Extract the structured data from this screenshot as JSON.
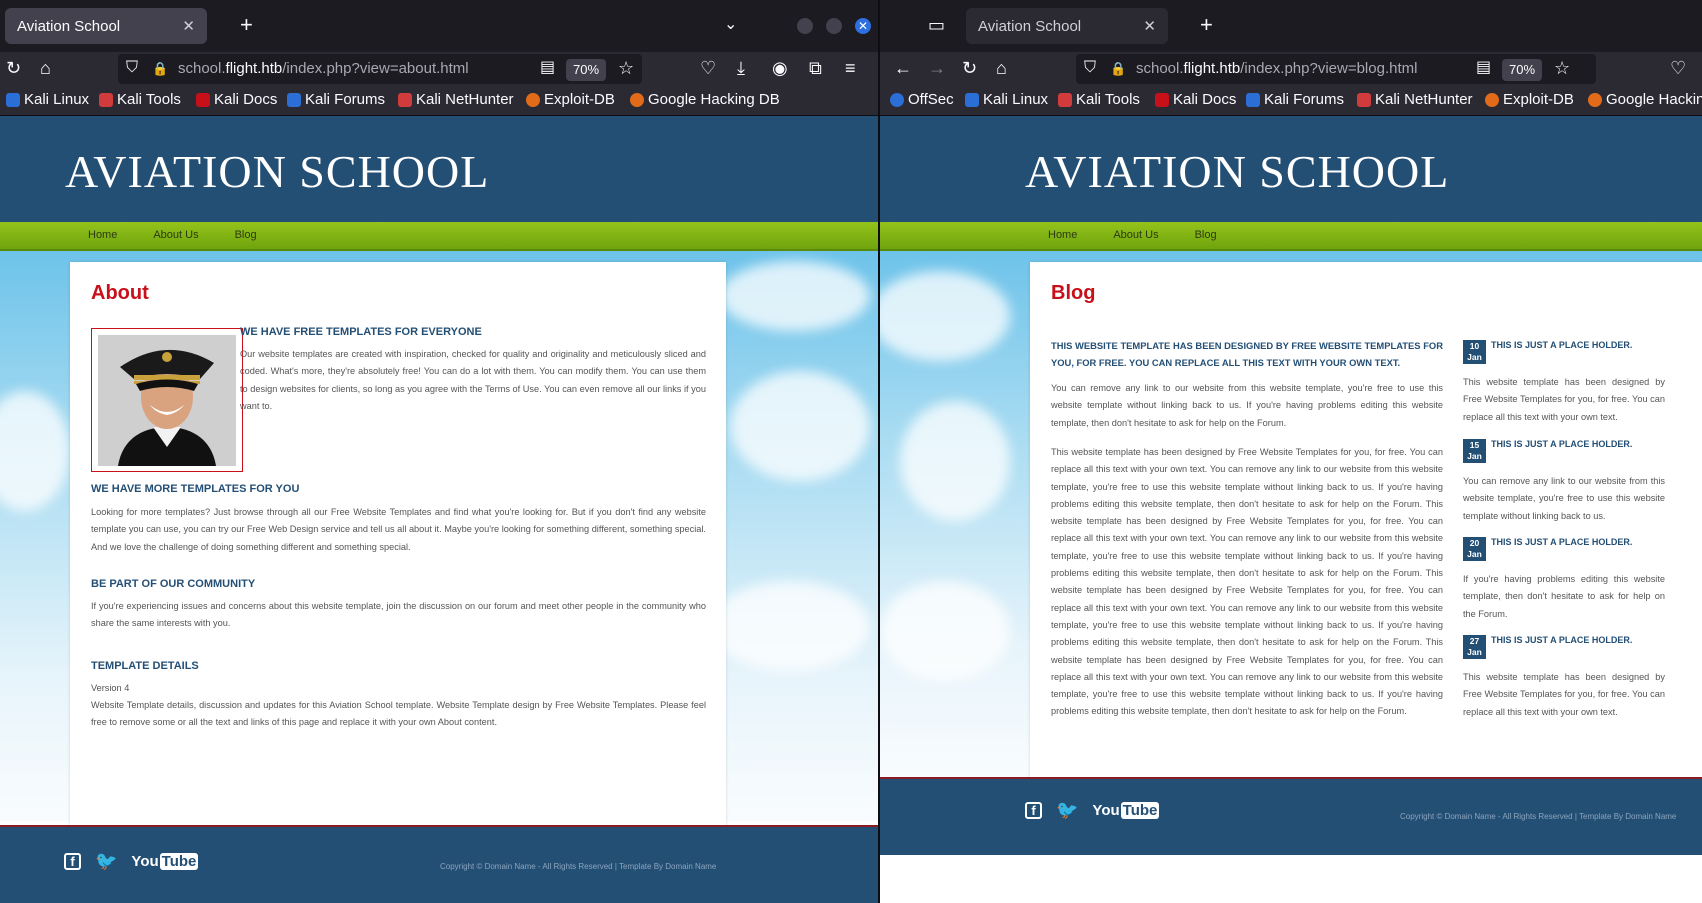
{
  "left_window": {
    "tab_title": "Aviation School",
    "url_prefix": "school.",
    "url_domain": "flight.htb",
    "url_path": "/index.php?view=about.html",
    "zoom": "70%",
    "bookmarks": [
      "Kali Linux",
      "Kali Tools",
      "Kali Docs",
      "Kali Forums",
      "Kali NetHunter",
      "Exploit-DB",
      "Google Hacking DB"
    ],
    "site": {
      "logo": "AVIATION SCHOOL",
      "menu": [
        "Home",
        "About Us",
        "Blog"
      ],
      "page_title": "About",
      "sections": [
        {
          "heading": "WE HAVE FREE TEMPLATES FOR EVERYONE",
          "text": "Our website templates are created with inspiration, checked for quality and originality and meticulously sliced and coded. What's more, they're absolutely free! You can do a lot with them. You can modify them. You can use them to design websites for clients, so long as you agree with the Terms of Use. You can even remove all our links if you want to."
        },
        {
          "heading": "WE HAVE MORE TEMPLATES FOR YOU",
          "text": "Looking for more templates? Just browse through all our Free Website Templates and find what you're looking for. But if you don't find any website template you can use, you can try our Free Web Design service and tell us all about it. Maybe you're looking for something different, something special. And we love the challenge of doing something different and something special."
        },
        {
          "heading": "BE PART OF OUR COMMUNITY",
          "text": "If you're experiencing issues and concerns about this website template, join the discussion on our forum and meet other people in the community who share the same interests with you."
        },
        {
          "heading": "TEMPLATE DETAILS",
          "version": "Version 4",
          "text": "Website Template details, discussion and updates for this Aviation School template. Website Template design by Free Website Templates. Please feel free to remove some or all the text and links of this page and replace it with your own About content."
        }
      ],
      "social": {
        "facebook": "f",
        "youtube_you": "You",
        "youtube_tube": "Tube"
      },
      "copyright": "Copyright © Domain Name - All Rights Reserved | Template By Domain Name"
    }
  },
  "right_window": {
    "tab_title": "Aviation School",
    "url_prefix": "school.",
    "url_domain": "flight.htb",
    "url_path": "/index.php?view=blog.html",
    "zoom": "70%",
    "bookmarks": [
      "OffSec",
      "Kali Linux",
      "Kali Tools",
      "Kali Docs",
      "Kali Forums",
      "Kali NetHunter",
      "Exploit-DB",
      "Google Hackin"
    ],
    "site": {
      "logo": "AVIATION SCHOOL",
      "menu": [
        "Home",
        "About Us",
        "Blog"
      ],
      "page_title": "Blog",
      "main_heading": "THIS WEBSITE TEMPLATE HAS BEEN DESIGNED BY FREE WEBSITE TEMPLATES FOR YOU, FOR FREE. YOU CAN REPLACE ALL THIS TEXT WITH YOUR OWN TEXT.",
      "main_p1": "You can remove any link to our website from this website template, you're free to use this website template without linking back to us. If you're having problems editing this website template, then don't hesitate to ask for help on the Forum.",
      "main_p2": "This website template has been designed by Free Website Templates for you, for free. You can replace all this text with your own text. You can remove any link to our website from this website template, you're free to use this website template without linking back to us. If you're having problems editing this website template, then don't hesitate to ask for help on the Forum. This website template has been designed by Free Website Templates for you, for free. You can replace all this text with your own text. You can remove any link to our website from this website template, you're free to use this website template without linking back to us. If you're having problems editing this website template, then don't hesitate to ask for help on the Forum. This website template has been designed by Free Website Templates for you, for free. You can replace all this text with your own text. You can remove any link to our website from this website template, you're free to use this website template without linking back to us. If you're having problems editing this website template, then don't hesitate to ask for help on the Forum. This website template has been designed by Free Website Templates for you, for free. You can replace all this text with your own text. You can remove any link to our website from this website template, you're free to use this website template without linking back to us. If you're having problems editing this website template, then don't hesitate to ask for help on the Forum.",
      "posts": [
        {
          "day": "10",
          "month": "Jan",
          "title": "THIS IS JUST A PLACE HOLDER.",
          "text": "This website template has been designed by Free Website Templates for you, for free. You can replace all this text with your own text."
        },
        {
          "day": "15",
          "month": "Jan",
          "title": "THIS IS JUST A PLACE HOLDER.",
          "text": "You can remove any link to our website from this website template, you're free to use this website template without linking back to us."
        },
        {
          "day": "20",
          "month": "Jan",
          "title": "THIS IS JUST A PLACE HOLDER.",
          "text": "If you're having problems editing this website template, then don't hesitate to ask for help on the Forum."
        },
        {
          "day": "27",
          "month": "Jan",
          "title": "THIS IS JUST A PLACE HOLDER.",
          "text": "This website template has been designed by Free Website Templates for you, for free. You can replace all this text with your own text."
        }
      ],
      "social": {
        "facebook": "f",
        "youtube_you": "You",
        "youtube_tube": "Tube"
      },
      "copyright": "Copyright © Domain Name - All Rights Reserved | Template By Domain Name"
    }
  },
  "icons": {
    "close": "✕",
    "plus": "+",
    "chevron_down": "⌄",
    "reload": "↻",
    "home": "⌂",
    "back": "←",
    "forward": "→",
    "shield": "⛉",
    "lock": "🔒",
    "reader": "▤",
    "star": "☆",
    "pocket": "♡",
    "download": "⤓",
    "account": "◉",
    "extensions": "⧉",
    "menu": "≡",
    "tabs": "▭",
    "twitter": "🐦"
  },
  "colors": {
    "brand_blue": "#244f75",
    "accent_red": "#c8101a",
    "green_bar": "#7fb014"
  }
}
